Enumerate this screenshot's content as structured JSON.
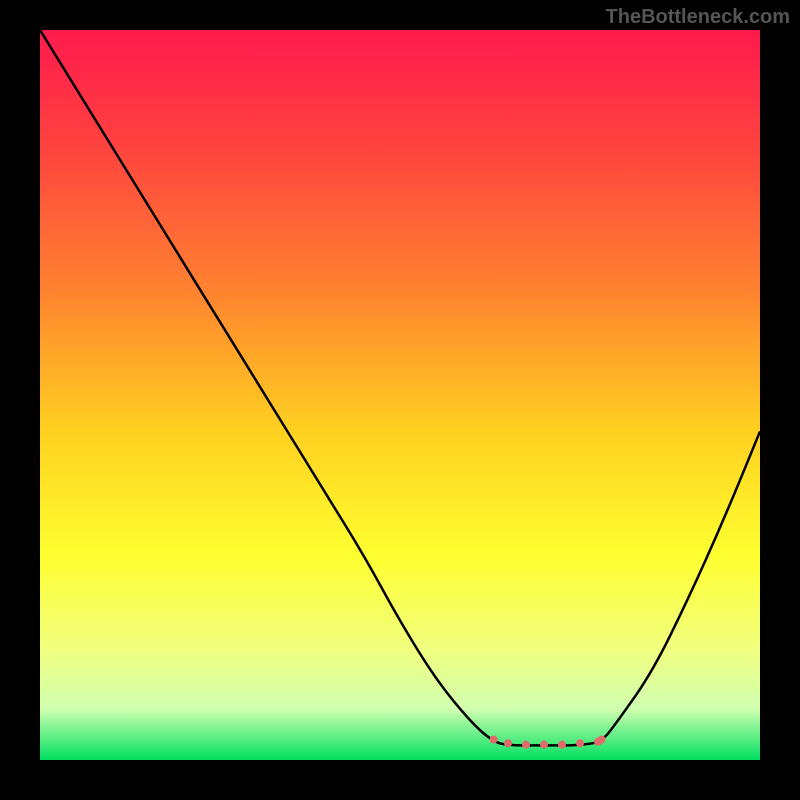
{
  "watermark": "TheBottleneck.com",
  "chart_data": {
    "type": "line",
    "title": "",
    "xlabel": "",
    "ylabel": "",
    "xlim": [
      0,
      100
    ],
    "ylim": [
      0,
      100
    ],
    "background_gradient": {
      "stops": [
        {
          "offset": 0.0,
          "color": "#ff1a4d"
        },
        {
          "offset": 0.15,
          "color": "#ff4040"
        },
        {
          "offset": 0.35,
          "color": "#ff8030"
        },
        {
          "offset": 0.55,
          "color": "#ffd020"
        },
        {
          "offset": 0.72,
          "color": "#ffff30"
        },
        {
          "offset": 0.85,
          "color": "#f0ff80"
        },
        {
          "offset": 0.93,
          "color": "#d0ffb0"
        },
        {
          "offset": 1.0,
          "color": "#00e060"
        }
      ]
    },
    "series": [
      {
        "name": "curve",
        "x": [
          0,
          5,
          10,
          15,
          20,
          25,
          30,
          35,
          40,
          45,
          50,
          55,
          60,
          63,
          65,
          70,
          75,
          78,
          80,
          85,
          90,
          95,
          100
        ],
        "values": [
          100,
          92,
          84,
          76,
          68,
          60,
          52,
          44,
          36,
          28,
          19,
          11,
          5,
          2.5,
          2,
          2,
          2,
          2.5,
          5,
          12,
          22,
          33,
          45
        ]
      }
    ],
    "bumps": {
      "x": [
        63,
        65,
        67.5,
        70,
        72.5,
        75,
        77.5,
        78
      ],
      "y": [
        2.8,
        2.3,
        2.1,
        2.1,
        2.1,
        2.3,
        2.5,
        2.8
      ],
      "color": "#e26a6a",
      "radius": 4
    }
  }
}
